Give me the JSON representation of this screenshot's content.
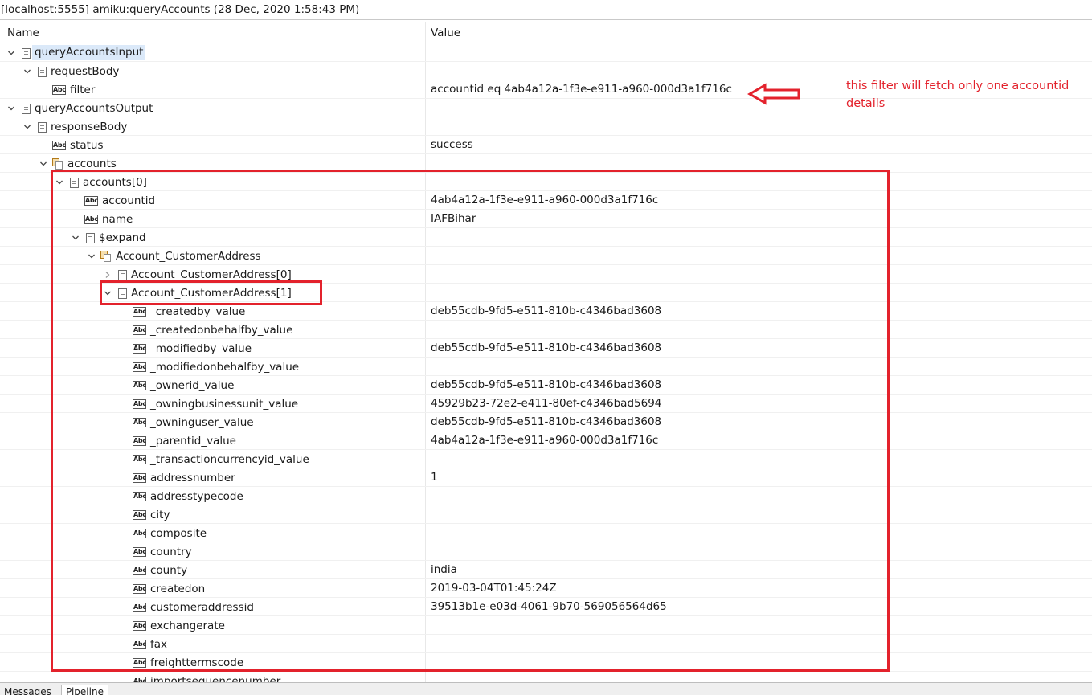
{
  "window_title": "[localhost:5555] amiku:queryAccounts (28 Dec, 2020 1:58:43 PM)",
  "columns": {
    "name": "Name",
    "value": "Value"
  },
  "rows": [
    {
      "label": "queryAccountsInput",
      "value": "",
      "level": 0,
      "icon": "document-icon",
      "toggle": "expanded",
      "selected": true
    },
    {
      "label": "requestBody",
      "value": "",
      "level": 1,
      "icon": "document-icon",
      "toggle": "expanded"
    },
    {
      "label": "filter",
      "value": "accountid eq 4ab4a12a-1f3e-e911-a960-000d3a1f716c",
      "level": 2,
      "icon": "string-field-icon",
      "toggle": "none"
    },
    {
      "label": "queryAccountsOutput",
      "value": "",
      "level": 0,
      "icon": "document-icon",
      "toggle": "expanded"
    },
    {
      "label": "responseBody",
      "value": "",
      "level": 1,
      "icon": "document-icon",
      "toggle": "expanded"
    },
    {
      "label": "status",
      "value": "success",
      "level": 2,
      "icon": "string-field-icon",
      "toggle": "none"
    },
    {
      "label": "accounts",
      "value": "",
      "level": 2,
      "icon": "document-list-icon",
      "toggle": "expanded"
    },
    {
      "label": "accounts[0]",
      "value": "",
      "level": 3,
      "icon": "document-icon",
      "toggle": "expanded"
    },
    {
      "label": "accountid",
      "value": "4ab4a12a-1f3e-e911-a960-000d3a1f716c",
      "level": 4,
      "icon": "string-field-icon",
      "toggle": "none"
    },
    {
      "label": "name",
      "value": "IAFBihar",
      "level": 4,
      "icon": "string-field-icon",
      "toggle": "none"
    },
    {
      "label": "$expand",
      "value": "",
      "level": 4,
      "icon": "document-icon",
      "toggle": "expanded"
    },
    {
      "label": "Account_CustomerAddress",
      "value": "",
      "level": 5,
      "icon": "document-list-icon",
      "toggle": "expanded"
    },
    {
      "label": "Account_CustomerAddress[0]",
      "value": "",
      "level": 6,
      "icon": "document-icon",
      "toggle": "collapsed"
    },
    {
      "label": "Account_CustomerAddress[1]",
      "value": "",
      "level": 6,
      "icon": "document-icon",
      "toggle": "expanded"
    },
    {
      "label": "_createdby_value",
      "value": "deb55cdb-9fd5-e511-810b-c4346bad3608",
      "level": 7,
      "icon": "string-field-icon",
      "toggle": "none"
    },
    {
      "label": "_createdonbehalfby_value",
      "value": "",
      "level": 7,
      "icon": "string-field-icon",
      "toggle": "none"
    },
    {
      "label": "_modifiedby_value",
      "value": "deb55cdb-9fd5-e511-810b-c4346bad3608",
      "level": 7,
      "icon": "string-field-icon",
      "toggle": "none"
    },
    {
      "label": "_modifiedonbehalfby_value",
      "value": "",
      "level": 7,
      "icon": "string-field-icon",
      "toggle": "none"
    },
    {
      "label": "_ownerid_value",
      "value": "deb55cdb-9fd5-e511-810b-c4346bad3608",
      "level": 7,
      "icon": "string-field-icon",
      "toggle": "none"
    },
    {
      "label": "_owningbusinessunit_value",
      "value": "45929b23-72e2-e411-80ef-c4346bad5694",
      "level": 7,
      "icon": "string-field-icon",
      "toggle": "none"
    },
    {
      "label": "_owninguser_value",
      "value": "deb55cdb-9fd5-e511-810b-c4346bad3608",
      "level": 7,
      "icon": "string-field-icon",
      "toggle": "none"
    },
    {
      "label": "_parentid_value",
      "value": "4ab4a12a-1f3e-e911-a960-000d3a1f716c",
      "level": 7,
      "icon": "string-field-icon",
      "toggle": "none"
    },
    {
      "label": "_transactioncurrencyid_value",
      "value": "",
      "level": 7,
      "icon": "string-field-icon",
      "toggle": "none"
    },
    {
      "label": "addressnumber",
      "value": "1",
      "level": 7,
      "icon": "string-field-icon",
      "toggle": "none"
    },
    {
      "label": "addresstypecode",
      "value": "",
      "level": 7,
      "icon": "string-field-icon",
      "toggle": "none"
    },
    {
      "label": "city",
      "value": "",
      "level": 7,
      "icon": "string-field-icon",
      "toggle": "none"
    },
    {
      "label": "composite",
      "value": "",
      "level": 7,
      "icon": "string-field-icon",
      "toggle": "none"
    },
    {
      "label": "country",
      "value": "",
      "level": 7,
      "icon": "string-field-icon",
      "toggle": "none"
    },
    {
      "label": "county",
      "value": "india",
      "level": 7,
      "icon": "string-field-icon",
      "toggle": "none"
    },
    {
      "label": "createdon",
      "value": "2019-03-04T01:45:24Z",
      "level": 7,
      "icon": "string-field-icon",
      "toggle": "none"
    },
    {
      "label": "customeraddressid",
      "value": "39513b1e-e03d-4061-9b70-569056564d65",
      "level": 7,
      "icon": "string-field-icon",
      "toggle": "none"
    },
    {
      "label": "exchangerate",
      "value": "",
      "level": 7,
      "icon": "string-field-icon",
      "toggle": "none"
    },
    {
      "label": "fax",
      "value": "",
      "level": 7,
      "icon": "string-field-icon",
      "toggle": "none"
    },
    {
      "label": "freighttermscode",
      "value": "",
      "level": 7,
      "icon": "string-field-icon",
      "toggle": "none"
    },
    {
      "label": "importsequencenumber",
      "value": "",
      "level": 7,
      "icon": "string-field-icon",
      "toggle": "none"
    }
  ],
  "annotation": {
    "note": "this filter will fetch only one accountid details",
    "color": "#e3222c"
  },
  "bottom_tabs": [
    "Messages",
    "Pipeline"
  ],
  "colors": {
    "selection": "#dbe9f9",
    "annotation_red": "#e3222c"
  }
}
